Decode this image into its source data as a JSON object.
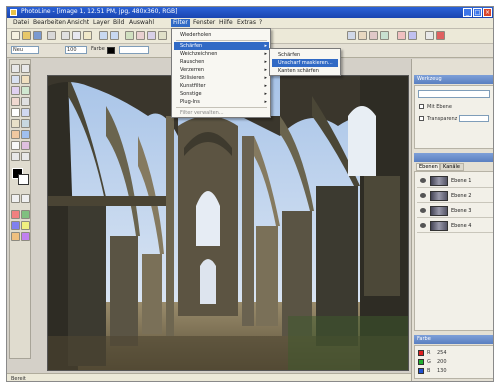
{
  "window": {
    "title": "PhotoLine - [image 1, 12.51 PM, jpg, 480x360, RGB]",
    "minimize_label": "_",
    "maximize_label": "□",
    "close_label": "×"
  },
  "menubar": {
    "items": [
      "Datei",
      "Bearbeiten",
      "Ansicht",
      "Layer",
      "Bild",
      "Auswahl",
      "Filter",
      "Fenster",
      "Hilfe",
      "Extras",
      "?"
    ],
    "active_index": 6
  },
  "options_bar": {
    "mode_value": "Neu",
    "size_value": "100",
    "color_label": "Farbe"
  },
  "filter_menu": {
    "items": [
      {
        "label": "Wiederholen",
        "submenu": false
      },
      {
        "label": "Schärfen",
        "submenu": true,
        "highlighted": true
      },
      {
        "label": "Weichzeichnen",
        "submenu": true
      },
      {
        "label": "Rauschen",
        "submenu": true
      },
      {
        "label": "Verzerren",
        "submenu": true
      },
      {
        "label": "Stilisieren",
        "submenu": true
      },
      {
        "label": "Kunstfilter",
        "submenu": true
      },
      {
        "label": "Sonstige",
        "submenu": true
      },
      {
        "label": "Plug-Ins",
        "submenu": true
      }
    ],
    "footer_label": "Filter verwalten..."
  },
  "filter_submenu": {
    "items": [
      {
        "label": "Schärfen",
        "highlighted": false
      },
      {
        "label": "Unscharf maskieren...",
        "highlighted": true
      },
      {
        "label": "Kanten schärfen",
        "highlighted": false
      }
    ]
  },
  "right_panel": {
    "tool_panel_title": "Werkzeug",
    "option_a": "Mit Ebene",
    "option_b": "Transparenz",
    "layers_tab_a": "Ebenen",
    "layers_tab_b": "Kanäle",
    "layers": [
      {
        "name": "Ebene 1"
      },
      {
        "name": "Ebene 2"
      },
      {
        "name": "Ebene 3"
      },
      {
        "name": "Ebene 4"
      }
    ],
    "color_panel_title": "Farbe",
    "color_rows": [
      {
        "label": "R",
        "value": "254",
        "color": "#e02020"
      },
      {
        "label": "G",
        "value": "200",
        "color": "#20b030"
      },
      {
        "label": "B",
        "value": "130",
        "color": "#2050d0"
      }
    ]
  },
  "statusbar": {
    "text": "Bereit"
  },
  "colors": {
    "title_bar": "#1a45b0",
    "menu_highlight": "#316ac5",
    "panel_bg": "#e4e0d4"
  }
}
